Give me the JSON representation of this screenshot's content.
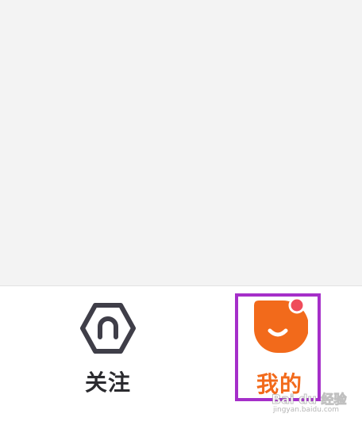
{
  "tabbar": {
    "tabs": [
      {
        "id": "follow",
        "label": "关注",
        "icon": "hexagon-arch-icon",
        "active": false
      },
      {
        "id": "mine",
        "label": "我的",
        "icon": "smile-face-icon",
        "active": true,
        "badge": "dot"
      }
    ]
  },
  "colors": {
    "content_background": "#f3f3f3",
    "inactive": "#2b2b2f",
    "active": "#f26a1b",
    "badge": "#ef4b5b",
    "highlight": "#a52fc9"
  },
  "watermark": {
    "text": "Bai du 经验",
    "sub": "jingyan.baidu.com"
  }
}
